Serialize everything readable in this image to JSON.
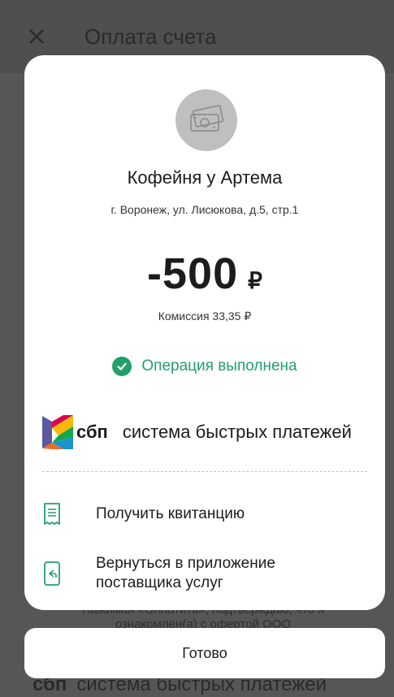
{
  "background": {
    "title": "Оплата счета",
    "consent_text": "Нажимая «Оплатить», подтверждаю, что я",
    "consent_text_2": "ознакомлен(а) с офертой ООО",
    "sbp_brand": "сбп",
    "sbp_text": "система быстрых платежей"
  },
  "receipt": {
    "merchant_name": "Кофейня у Артема",
    "merchant_address": "г. Воронеж, ул. Лисюкова, д.5, стр.1",
    "amount": "-500",
    "currency": "₽",
    "commission": "Комиссия 33,35 ₽",
    "status": "Операция выполнена",
    "sbp_brand": "сбп",
    "sbp_text": "система быстрых платежей",
    "actions": [
      {
        "label": "Получить квитанцию",
        "icon": "receipt-icon"
      },
      {
        "label": "Вернуться в приложение поставщика услуг",
        "icon": "return-to-app-icon"
      }
    ]
  },
  "done_label": "Готово",
  "colors": {
    "accent_green": "#22a06b",
    "overlay": "#565656"
  }
}
